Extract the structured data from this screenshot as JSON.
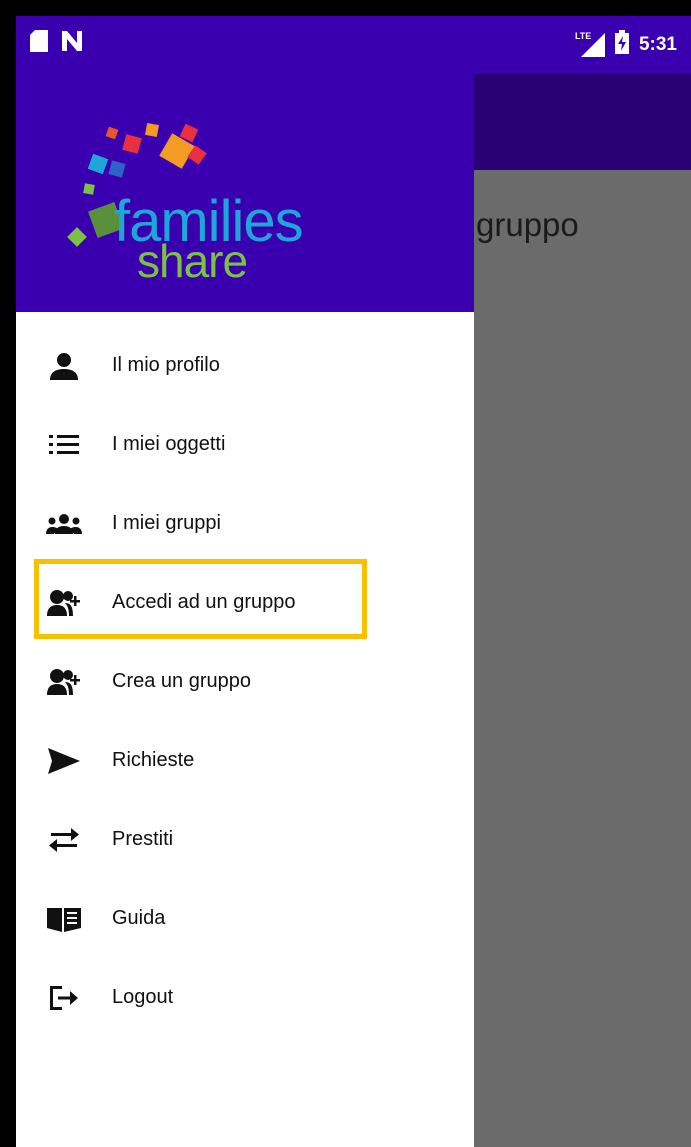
{
  "status_bar": {
    "time": "5:31",
    "network_label": "LTE",
    "icons": [
      "sd-card-icon",
      "n-notification-icon",
      "signal-icon",
      "battery-charging-icon"
    ]
  },
  "main": {
    "partial_title": "gruppo"
  },
  "drawer": {
    "logo": {
      "line1": "families",
      "line2": "share"
    },
    "items": [
      {
        "label": "Il mio profilo",
        "icon": "person-icon"
      },
      {
        "label": "I miei oggetti",
        "icon": "list-icon"
      },
      {
        "label": "I miei gruppi",
        "icon": "group-icon"
      },
      {
        "label": "Accedi ad un gruppo",
        "icon": "person-add-icon",
        "highlighted": true
      },
      {
        "label": "Crea un gruppo",
        "icon": "person-add-icon"
      },
      {
        "label": "Richieste",
        "icon": "send-icon"
      },
      {
        "label": "Prestiti",
        "icon": "swap-icon"
      },
      {
        "label": "Guida",
        "icon": "book-icon"
      },
      {
        "label": "Logout",
        "icon": "logout-icon"
      }
    ]
  },
  "colors": {
    "header": "#3a00b0",
    "toolbar": "#2a0075",
    "scrim": "#6b6b6b",
    "highlight": "#f7c000",
    "logo_blue": "#1ea6d8",
    "logo_green": "#7cc242"
  }
}
